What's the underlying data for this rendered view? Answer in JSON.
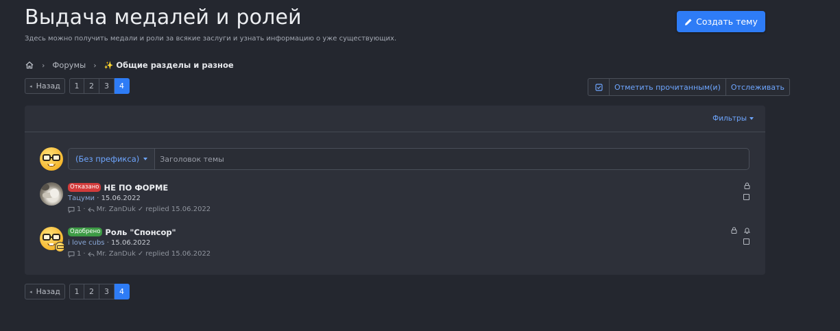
{
  "header": {
    "title": "Выдача медалей и ролей",
    "description": "Здесь можно получить медали и роли за всякие заслуги и узнать информацию о уже существующих.",
    "create_button": "Создать тему",
    "create_icon": "pencil-icon"
  },
  "breadcrumb": {
    "home_icon": "home-icon",
    "items": [
      "Форумы"
    ],
    "current_prefix": "✨",
    "current": "Общие разделы и разное"
  },
  "pagination": {
    "back_label": "Назад",
    "pages": [
      "1",
      "2",
      "3",
      "4"
    ],
    "active_page": "4"
  },
  "actions": {
    "check_icon": "checkbox-icon",
    "mark_read": "Отметить прочитанным(и)",
    "watch": "Отслеживать"
  },
  "panel": {
    "filters_label": "Фильтры"
  },
  "new_thread": {
    "prefix_label": "(Без префикса)",
    "title_placeholder": "Заголовок темы"
  },
  "threads": [
    {
      "status": "Отказано",
      "status_color": "#d23b3b",
      "title": "НЕ ПО ФОРМЕ",
      "author": "Тацуми",
      "date": "15.06.2022",
      "replies": "1",
      "last_poster": "Mr. ZanDuk",
      "replied_label": "replied 15.06.2022",
      "icons": [
        "lock-icon"
      ]
    },
    {
      "status": "Одобрено",
      "status_color": "#3d9b45",
      "title": "Роль \"Спонсор\"",
      "author": "i love cubs",
      "date": "15.06.2022",
      "replies": "1",
      "last_poster": "Mr. ZanDuk",
      "replied_label": "replied 15.06.2022",
      "icons": [
        "lock-icon",
        "bell-icon"
      ]
    }
  ]
}
